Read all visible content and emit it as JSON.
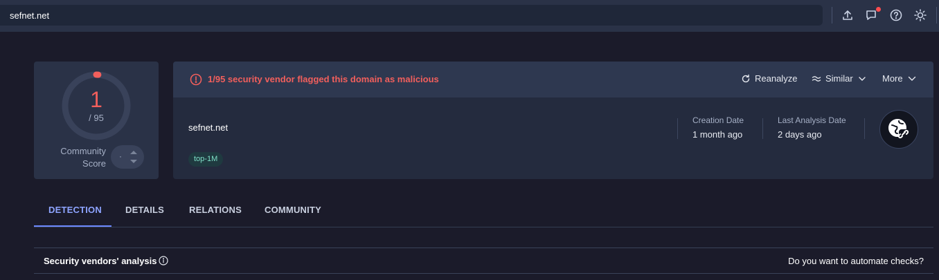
{
  "search": {
    "value": "sefnet.net"
  },
  "toolbar": {
    "icons": [
      "upload-icon",
      "notification-chat-icon",
      "help-icon",
      "theme-sun-icon"
    ],
    "notification_dot_color": "#ff4d4f"
  },
  "score": {
    "detections": "1",
    "total": "/ 95",
    "fraction": 0.0105,
    "community_label": "Community\nScore",
    "community_value": "·"
  },
  "alert": {
    "text": "1/95 security vendor flagged this domain as malicious",
    "color": "#f25f5c"
  },
  "actions": {
    "reanalyze": "Reanalyze",
    "similar": "Similar",
    "more": "More"
  },
  "domain": {
    "name": "sefnet.net",
    "tag": "top-1M"
  },
  "meta": {
    "creation_label": "Creation Date",
    "creation_value": "1 month ago",
    "last_label": "Last Analysis Date",
    "last_value": "2 days ago"
  },
  "tabs": [
    {
      "label": "DETECTION",
      "active": true
    },
    {
      "label": "DETAILS",
      "active": false
    },
    {
      "label": "RELATIONS",
      "active": false
    },
    {
      "label": "COMMUNITY",
      "active": false
    }
  ],
  "vendors": {
    "title": "Security vendors' analysis",
    "automate": "Do you want to automate checks?"
  },
  "colors": {
    "accent": "#6d89ff",
    "malicious": "#f25f5c",
    "tag_bg": "#1f3a40",
    "tag_text": "#7fe0c8"
  }
}
